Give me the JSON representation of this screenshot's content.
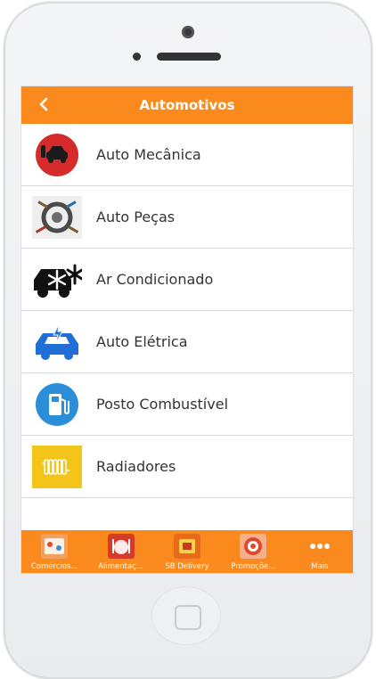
{
  "header": {
    "title": "Automotivos",
    "back_icon": "chevron-left-icon"
  },
  "categories": [
    {
      "label": "Auto Mecânica",
      "icon": "mechanic-car-icon"
    },
    {
      "label": "Auto Peças",
      "icon": "auto-parts-icon"
    },
    {
      "label": "Ar Condicionado",
      "icon": "air-conditioning-icon"
    },
    {
      "label": "Auto Elétrica",
      "icon": "electric-car-icon"
    },
    {
      "label": "Posto Combustível",
      "icon": "fuel-pump-icon"
    },
    {
      "label": "Radiadores",
      "icon": "radiator-icon"
    }
  ],
  "tabbar": {
    "tabs": [
      {
        "label": "Comércios...",
        "icon": "shops-icon"
      },
      {
        "label": "Alimentaç...",
        "icon": "food-icon"
      },
      {
        "label": "SB Delivery",
        "icon": "delivery-icon"
      },
      {
        "label": "Promoçõe...",
        "icon": "promotions-icon"
      },
      {
        "label": "Mais",
        "icon": "more-dots-icon"
      }
    ]
  },
  "colors": {
    "accent": "#fb8a1e",
    "text": "#333333",
    "divider": "#d8d8d8"
  }
}
